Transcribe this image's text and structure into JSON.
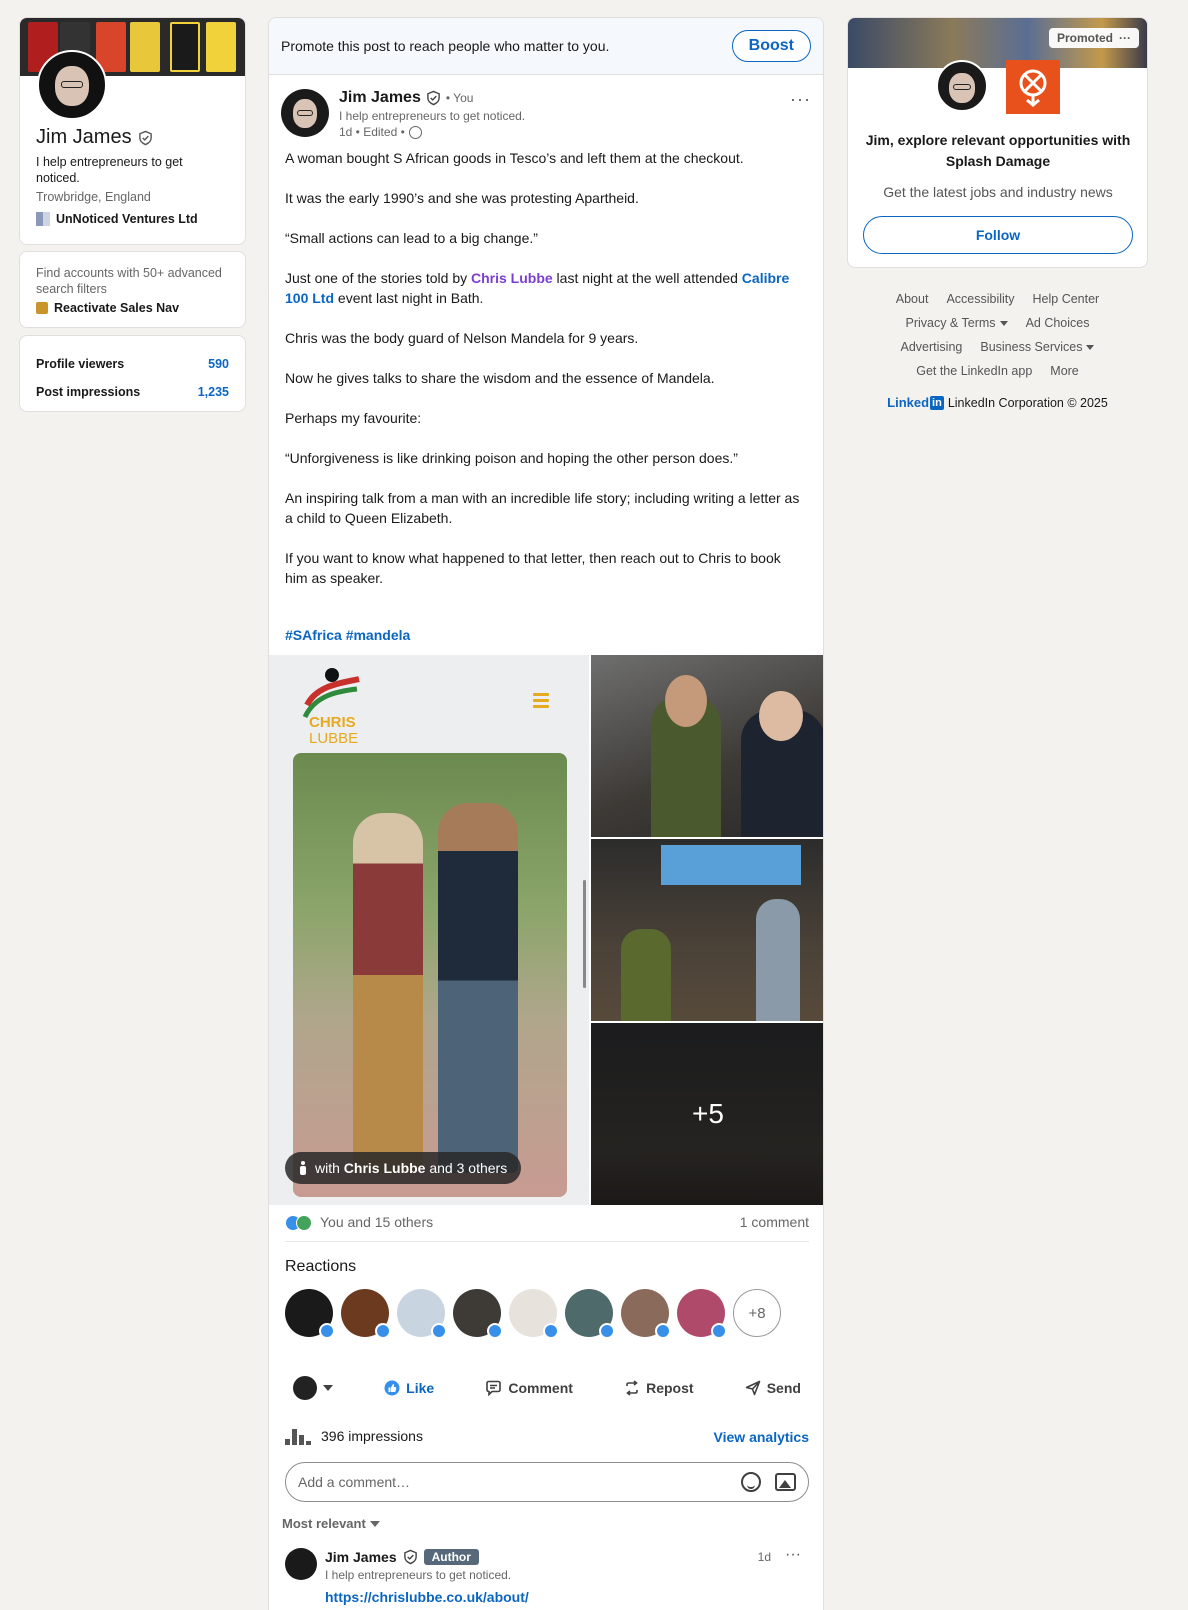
{
  "profile": {
    "name": "Jim James",
    "headline": "I help entrepreneurs to get noticed.",
    "location": "Trowbridge, England",
    "company": "UnNoticed Ventures Ltd"
  },
  "sales_nav": {
    "text": "Find accounts with 50+ advanced search filters",
    "link": "Reactivate Sales Nav"
  },
  "stats": [
    {
      "label": "Profile viewers",
      "value": "590"
    },
    {
      "label": "Post impressions",
      "value": "1,235"
    }
  ],
  "promote": {
    "text": "Promote this post to reach people who matter to you.",
    "boost_label": "Boost"
  },
  "post": {
    "author": "Jim James",
    "you_label": "• You",
    "headline": "I help entrepreneurs to get noticed.",
    "meta": "1d • Edited •",
    "menu": "···",
    "paragraphs": {
      "p1": "A woman bought S African goods in Tesco’s and left them at the checkout.",
      "p2": "It was the early 1990’s and she was protesting Apartheid.",
      "p3": "“Small actions can lead to a big change.”",
      "p4_pre": "Just one of the stories told by ",
      "p4_mention1": "Chris Lubbe",
      "p4_mid": " last night at the well attended ",
      "p4_mention2": "Calibre 100 Ltd",
      "p4_post": " event last night in Bath.",
      "p5": "Chris was the body guard of Nelson Mandela for 9 years.",
      "p6": "Now he gives talks to share the wisdom and the essence of Mandela.",
      "p7": "Perhaps my favourite:",
      "p8": "“Unforgiveness is like drinking poison and hoping the other person does.”",
      "p9": "An inspiring talk from a man with an incredible life story; including writing a letter as a child to Queen Elizabeth.",
      "p10": "If you want to know what happened to that letter, then reach out to Chris to book him as speaker."
    },
    "hashtags": "#SAfrica #mandela",
    "media": {
      "tag_prefix": "with ",
      "tag_name": "Chris Lubbe",
      "tag_suffix": " and 3 others",
      "more_count": "+5",
      "logo_line1": "CHRIS",
      "logo_line2": "LUBBE"
    },
    "reactions_summary": "You and 15 others",
    "comments_count": "1 comment",
    "reactions_heading": "Reactions",
    "reactors_more": "+8",
    "actions": {
      "like": "Like",
      "comment": "Comment",
      "repost": "Repost",
      "send": "Send"
    },
    "impressions": "396 impressions",
    "view_analytics": "View analytics",
    "comment_placeholder": "Add a comment…",
    "sort_label": "Most relevant"
  },
  "comment": {
    "author": "Jim James",
    "badge": "Author",
    "headline": "I help entrepreneurs to get noticed.",
    "time": "1d",
    "menu": "···",
    "link": "https://chrislubbe.co.uk/about/"
  },
  "ad": {
    "promoted_label": "Promoted",
    "promoted_menu": "···",
    "title": "Jim, explore relevant opportunities with Splash Damage",
    "subtitle": "Get the latest jobs and industry news",
    "follow_label": "Follow"
  },
  "footer": {
    "about": "About",
    "accessibility": "Accessibility",
    "help": "Help Center",
    "privacy": "Privacy & Terms",
    "ad_choices": "Ad Choices",
    "advertising": "Advertising",
    "business": "Business Services",
    "app": "Get the LinkedIn app",
    "more": "More",
    "brand_word": "Linked",
    "brand_in": "in",
    "copyright": "LinkedIn Corporation © 2025"
  },
  "colors": {
    "brand": "#0a66c2",
    "background": "#f4f2ee",
    "mention": "#7b3fd0",
    "ad_logo": "#e8511b"
  }
}
